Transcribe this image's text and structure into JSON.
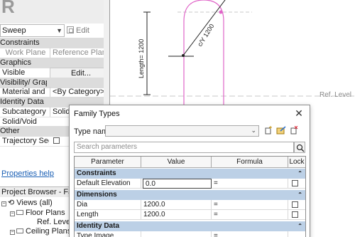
{
  "app": {
    "logo_letter": "R"
  },
  "properties": {
    "type_selector": "Sweep",
    "edit_type_label": "Edit Type",
    "sections": {
      "constraints": "Constraints",
      "graphics": "Graphics",
      "visibility": "Visibility/ Graphics",
      "identity": "Identity Data",
      "other": "Other"
    },
    "rows": {
      "work_plane_key": "Work Plane",
      "work_plane_val": "Reference Plane",
      "visible_key": "Visible",
      "visible_val": "Edit...",
      "material_key": "Material and",
      "material_val": "<By Category>",
      "subcategory_key": "Subcategory",
      "subcategory_val": "Solid/",
      "solid_void_key": "Solid/Void",
      "trajectory_key": "Trajectory Seg..."
    },
    "help_link": "Properties help",
    "project_browser_title": "Project Browser - Fa...",
    "tree": {
      "views": "Views (all)",
      "floor_plans": "Floor Plans",
      "ref_level": "Ref. Level",
      "ceiling_plans": "Ceiling Plans"
    }
  },
  "canvas": {
    "length_dim": "Length= 1200",
    "dia_dim": "c/Y 1200",
    "ref_level_label": "Ref. Level",
    "colors": {
      "pink": "#e064c8",
      "dim": "#222222",
      "dash": "#c8c8c8"
    }
  },
  "dialog": {
    "title": "Family Types",
    "close_glyph": "✕",
    "type_name_label": "Type name:",
    "type_name_value": "",
    "search_placeholder": "Search parameters",
    "columns": [
      "Parameter",
      "Value",
      "Formula",
      "Lock"
    ],
    "sections": [
      {
        "name": "Constraints",
        "rows": [
          {
            "param": "Default Elevation",
            "value": "0.0",
            "formula": "="
          }
        ]
      },
      {
        "name": "Dimensions",
        "rows": [
          {
            "param": "Dia",
            "value": "1200.0",
            "formula": "="
          },
          {
            "param": "Length",
            "value": "1200.0",
            "formula": "="
          }
        ]
      },
      {
        "name": "Identity Data",
        "rows": [
          {
            "param": "Type Image",
            "value": "",
            "formula": "="
          }
        ]
      }
    ],
    "section_color": "#bcd0e6"
  }
}
